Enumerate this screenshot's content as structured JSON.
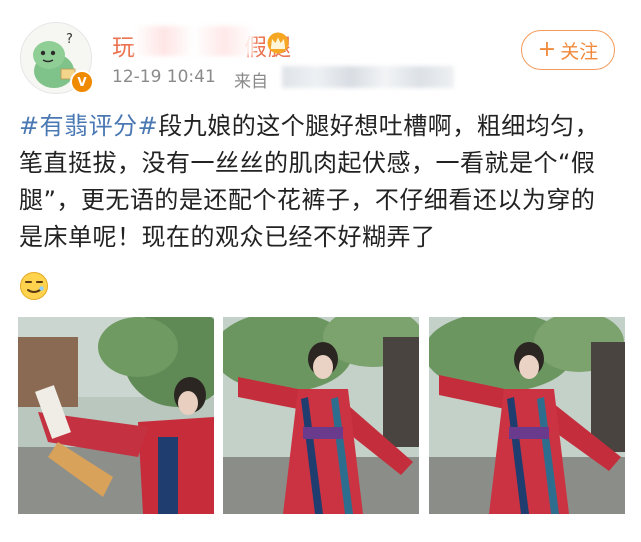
{
  "post": {
    "username": "玩",
    "username_suffix": "假腿",
    "timestamp": "12-19 10:41",
    "source_label": "来自",
    "follow_button": "关注",
    "topic": "#有翡评分#",
    "text": "段九娘的这个腿好想吐槽啊，粗细均匀，笔直挺拔，没有一丝丝的肌肉起伏感，一看就是个“假腿”，更无语的是还配个花裤子，不仔细看还以为穿的是床单呢！现在的观众已经不好糊弄了"
  },
  "icons": {
    "avatar": "cartoon-dinosaur-avatar",
    "badge": "verified-v-icon",
    "crown": "crown-icon",
    "emoji": "awkward-smile-emoji",
    "follow": "plus-icon"
  },
  "images": [
    {
      "label": "drama-still-1"
    },
    {
      "label": "drama-still-2"
    },
    {
      "label": "drama-still-3"
    }
  ],
  "colors": {
    "username": "#eb7350",
    "follow_border": "#f39b5e",
    "topic_link": "#4a78b3",
    "body_text": "#222222",
    "meta_text": "#8a8a8a"
  }
}
